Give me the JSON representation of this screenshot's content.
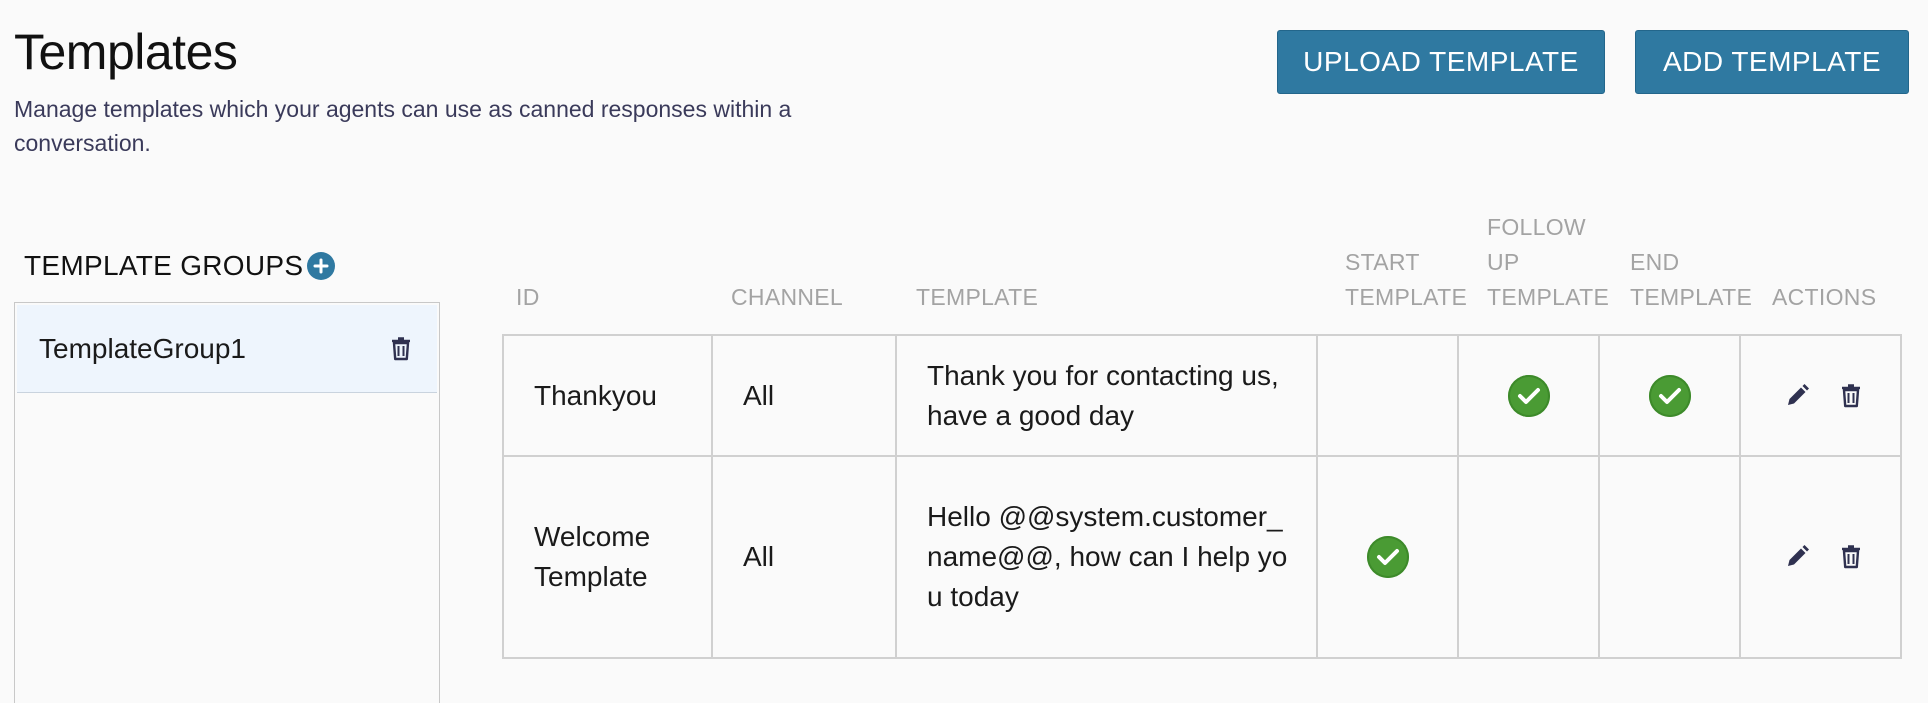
{
  "header": {
    "title": "Templates",
    "description": "Manage templates which your agents can use as canned responses within a conversation."
  },
  "toolbar": {
    "upload_label": "UPLOAD TEMPLATE",
    "add_label": "ADD TEMPLATE"
  },
  "sidebar": {
    "heading": "TEMPLATE GROUPS",
    "add_icon": "plus-circle-icon",
    "groups": [
      {
        "label": "TemplateGroup1",
        "delete_icon": "trash-icon"
      }
    ]
  },
  "table": {
    "columns": {
      "id": "ID",
      "channel": "CHANNEL",
      "template": "TEMPLATE",
      "start": [
        "START",
        "TEMPLATE"
      ],
      "follow_up": [
        "FOLLOW",
        "UP",
        "TEMPLATE"
      ],
      "end": [
        "END",
        "TEMPLATE"
      ],
      "actions": "ACTIONS"
    },
    "rows": [
      {
        "id": "Thankyou",
        "channel": "All",
        "template": "Thank you for contacting us, have a good day",
        "start_template": false,
        "follow_up_template": true,
        "end_template": true
      },
      {
        "id": "Welcome Template",
        "channel": "All",
        "template": "Hello @@system.customer_name@@, how can I help you today",
        "start_template": true,
        "follow_up_template": false,
        "end_template": false
      }
    ],
    "row_actions": [
      "edit-icon",
      "trash-icon"
    ]
  },
  "colors": {
    "primary": "#2f79a1",
    "check_green": "#4a9b34",
    "selected_row": "#eef5fd",
    "icon_dark": "#2f3150"
  }
}
